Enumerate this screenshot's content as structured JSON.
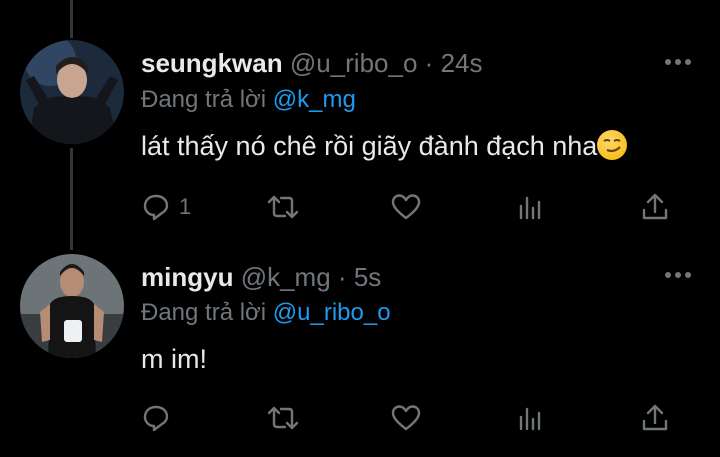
{
  "thread": {
    "tweets": [
      {
        "display_name": "seungkwan",
        "handle": "@u_ribo_o",
        "separator": "·",
        "time": "24s",
        "reply_prefix": "Đang trả lời",
        "reply_to": "@k_mg",
        "text": "lát thấy nó chê rồi giãy đành đạch nha",
        "emoji_icon": "smirking-face-emoji",
        "reply_count": "1"
      },
      {
        "display_name": "mingyu",
        "handle": "@k_mg",
        "separator": "·",
        "time": "5s",
        "reply_prefix": "Đang trả lời",
        "reply_to": "@u_ribo_o",
        "text": "m im!",
        "reply_count": ""
      }
    ]
  },
  "icons": {
    "reply": "reply-icon",
    "retweet": "retweet-icon",
    "like": "heart-icon",
    "views": "analytics-icon",
    "share": "share-icon",
    "more": "more-options-icon"
  },
  "colors": {
    "background": "#000000",
    "text": "#e7e9ea",
    "muted": "#71767b",
    "accent": "#1d9bf0",
    "thread_line": "#333639"
  }
}
